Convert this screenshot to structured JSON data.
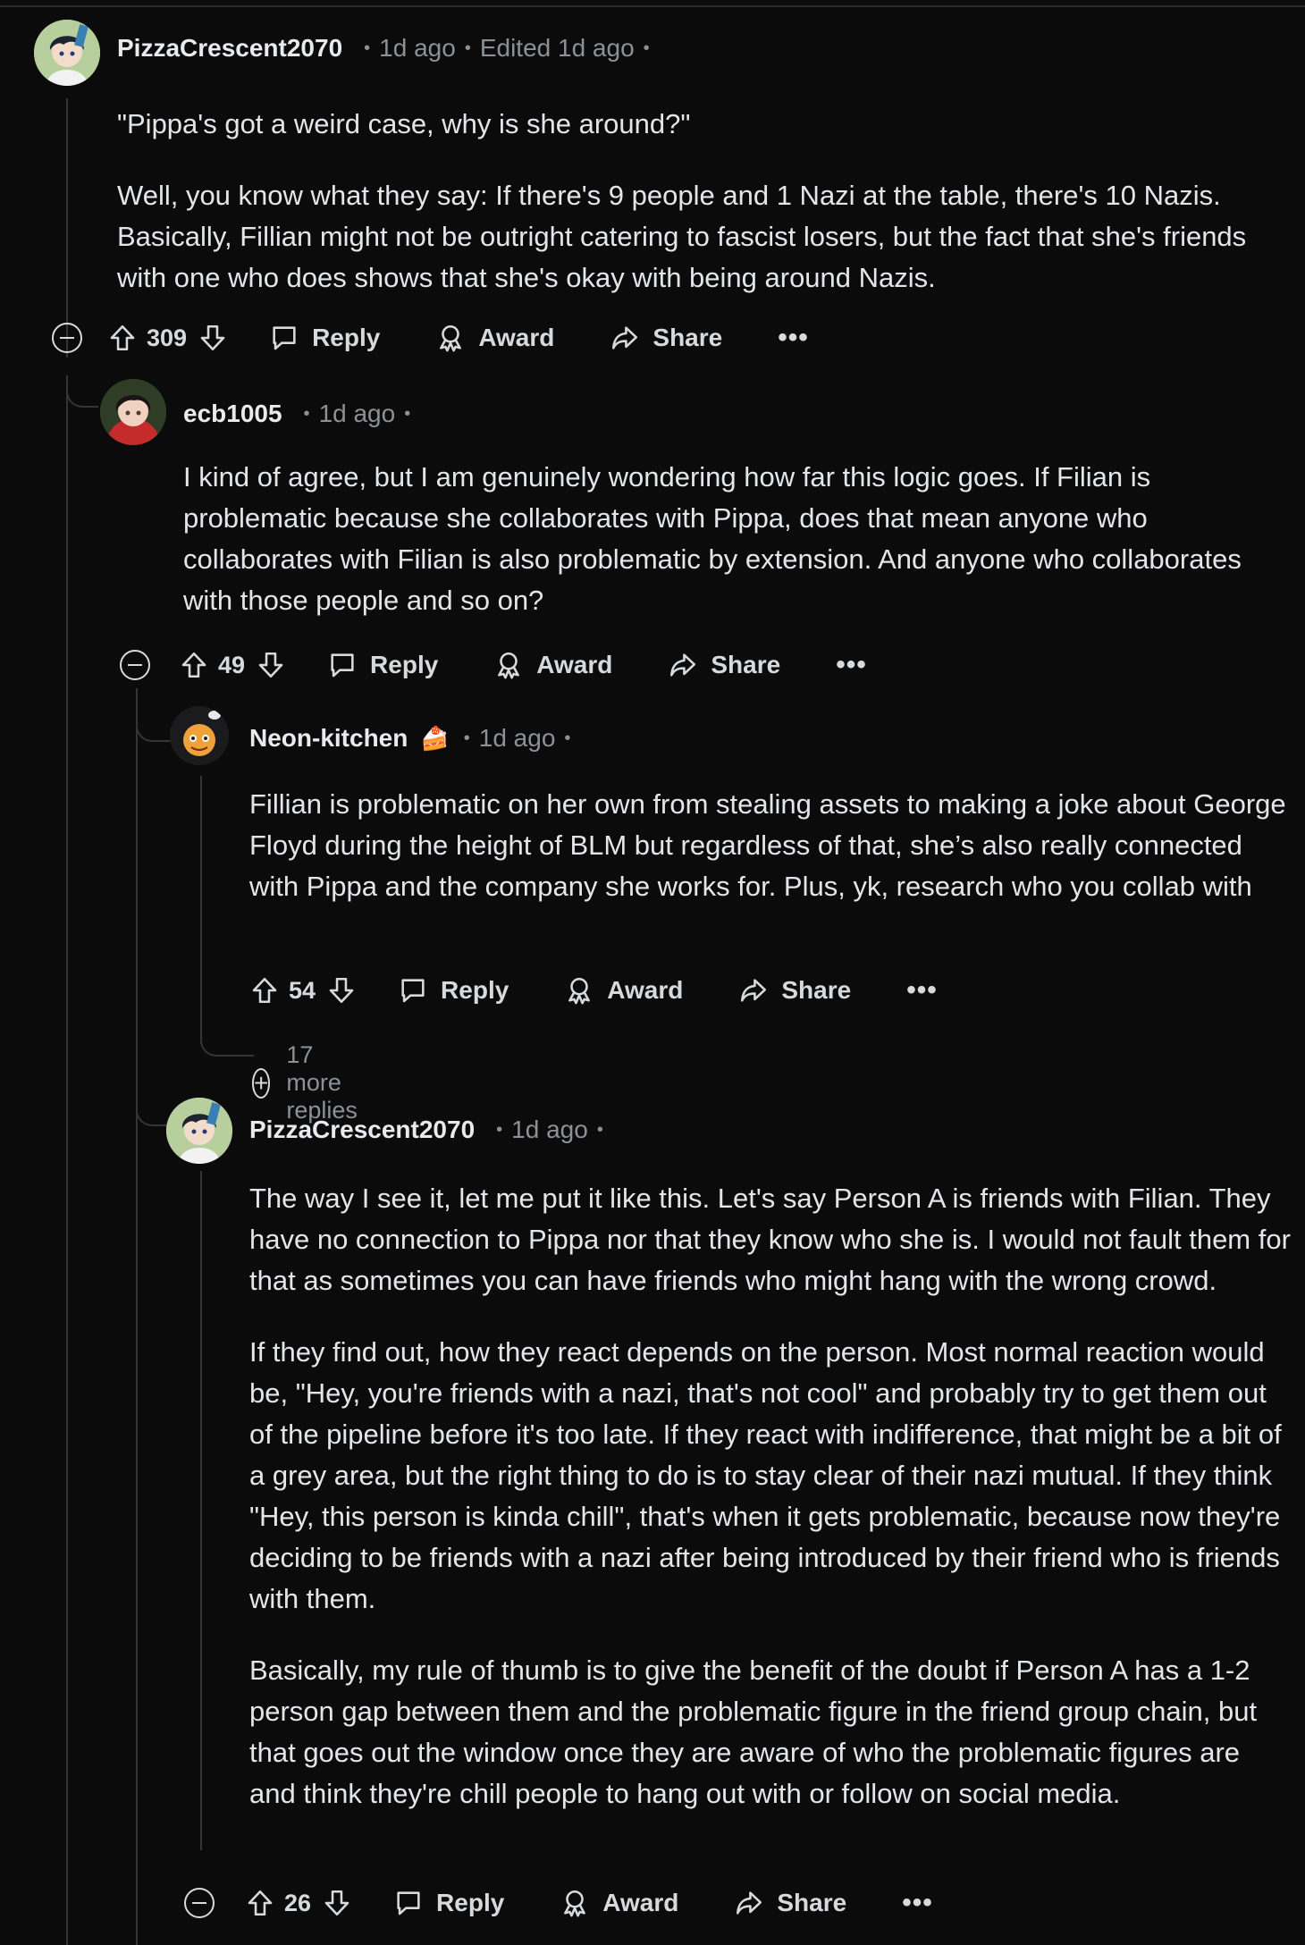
{
  "comments": [
    {
      "username": "PizzaCrescent2070",
      "time": "1d ago",
      "edited": "Edited 1d ago",
      "paragraphs": [
        "\"Pippa's got a weird case, why is she around?\"",
        "Well, you know what they say: If there's 9 people and 1 Nazi at the table, there's 10 Nazis. Basically, Fillian might not be outright catering to fascist losers, but the fact that she's friends with one who does shows that she's okay with being around Nazis."
      ],
      "votes": "309",
      "reply": "Reply",
      "award": "Award",
      "share": "Share",
      "more": "•••"
    },
    {
      "username": "ecb1005",
      "time": "1d ago",
      "paragraphs": [
        "I kind of agree, but I am genuinely wondering how far this logic goes. If Filian is problematic because she collaborates with Pippa, does that mean anyone who collaborates with Filian is also problematic by extension. And anyone who collaborates with those people and so on?"
      ],
      "votes": "49",
      "reply": "Reply",
      "award": "Award",
      "share": "Share",
      "more": "•••"
    },
    {
      "username": "Neon-kitchen",
      "flair": "🍰",
      "time": "1d ago",
      "paragraphs": [
        "Fillian is problematic on her own from stealing assets to making a joke about George Floyd during the height of BLM but regardless of that, she’s also really connected with Pippa and the company she works for. Plus, yk, research who you collab with"
      ],
      "votes": "54",
      "reply": "Reply",
      "award": "Award",
      "share": "Share",
      "more": "•••",
      "more_replies": "17 more replies"
    },
    {
      "username": "PizzaCrescent2070",
      "time": "1d ago",
      "paragraphs": [
        "The way I see it, let me put it like this. Let's say Person A is friends with Filian. They have no connection to Pippa nor that they know who she is. I would not fault them for that as sometimes you can have friends who might hang with the wrong crowd.",
        "If they find out, how they react depends on the person. Most normal reaction would be, \"Hey, you're friends with a nazi, that's not cool\" and probably try to get them out of the pipeline before it's too late. If they react with indifference, that might be a bit of a grey area, but the right thing to do is to stay clear of their nazi mutual. If they think \"Hey, this person is kinda chill\", that's when it gets problematic, because now they're deciding to be friends with a nazi after being introduced by their friend who is friends with them.",
        "Basically, my rule of thumb is to give the benefit of the doubt if Person A has a 1-2 person gap between them and the problematic figure in the friend group chain, but that goes out the window once they are aware of who the problematic figures are and think they're chill people to hang out with or follow on social media."
      ],
      "votes": "26",
      "reply": "Reply",
      "award": "Award",
      "share": "Share",
      "more": "•••"
    }
  ],
  "separator": "•",
  "colors": {
    "background": "#0b0b0c",
    "text": "#e3e5e8",
    "muted": "#8b9196",
    "thread_line": "#343536"
  }
}
